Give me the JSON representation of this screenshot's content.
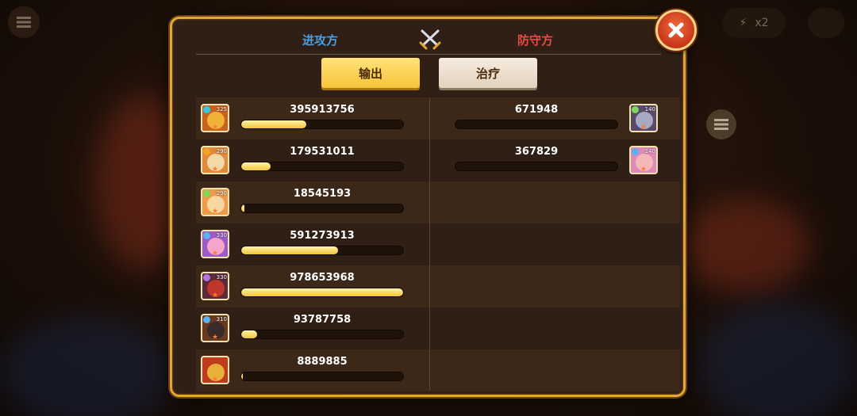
{
  "header": {
    "attacker_label": "进攻方",
    "defender_label": "防守方"
  },
  "tabs": [
    {
      "label": "输出",
      "selected": true
    },
    {
      "label": "治疗",
      "selected": false
    }
  ],
  "attackers": [
    {
      "damage": "395913756",
      "fill": 0.4,
      "level": "325",
      "element": "water",
      "colors": {
        "frame": "#c7631e",
        "face": "#f2b23a",
        "elem": "#36c9e6"
      }
    },
    {
      "damage": "179531011",
      "fill": 0.18,
      "level": "290",
      "element": "fire",
      "colors": {
        "frame": "#e18a3a",
        "face": "#f4d9a8",
        "elem": "#f7a028"
      }
    },
    {
      "damage": "18545193",
      "fill": 0.02,
      "level": "290",
      "element": "nature",
      "colors": {
        "frame": "#ee9a4a",
        "face": "#f6d7a0",
        "elem": "#7ed957"
      }
    },
    {
      "damage": "591273913",
      "fill": 0.6,
      "level": "330",
      "element": "water",
      "colors": {
        "frame": "#9c5ac9",
        "face": "#f5a6c8",
        "elem": "#5ab0f0"
      }
    },
    {
      "damage": "978653968",
      "fill": 1.0,
      "level": "330",
      "element": "dark",
      "colors": {
        "frame": "#5a2a3a",
        "face": "#c0362c",
        "elem": "#b078e0"
      }
    },
    {
      "damage": "93787758",
      "fill": 0.1,
      "level": "310",
      "element": "water",
      "colors": {
        "frame": "#6a3a20",
        "face": "#3a2a2a",
        "elem": "#5ab0f0"
      }
    },
    {
      "damage": "8889885",
      "fill": 0.01,
      "level": "",
      "element": "",
      "colors": {
        "frame": "#c23a1e",
        "face": "#e8b23a",
        "elem": ""
      }
    }
  ],
  "defenders": [
    {
      "damage": "671948",
      "fill": 0.0,
      "level": "140",
      "element": "nature",
      "colors": {
        "frame": "#5a4a6a",
        "face": "#a8a8c0",
        "elem": "#7ed957"
      }
    },
    {
      "damage": "367829",
      "fill": 0.0,
      "level": "140",
      "element": "water",
      "colors": {
        "frame": "#e08ab8",
        "face": "#f5b8b8",
        "elem": "#5ab0f0"
      }
    }
  ],
  "background": {
    "speed_label": "x2"
  }
}
